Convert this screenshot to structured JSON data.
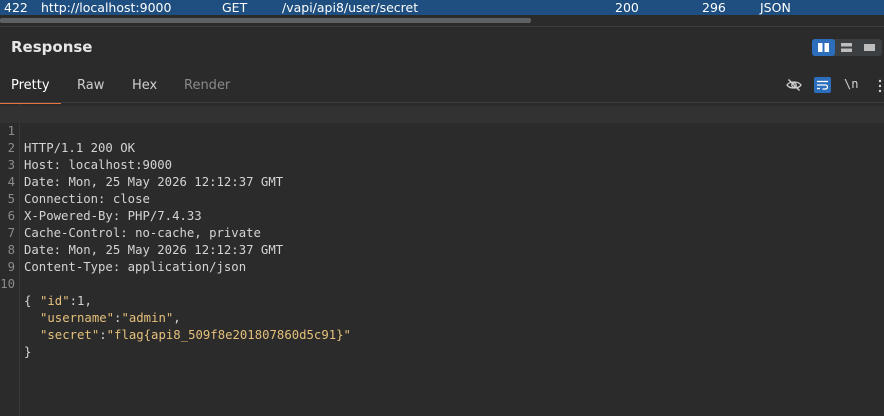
{
  "history_row": {
    "id": "422",
    "host": "http://localhost:9000",
    "method": "GET",
    "url": "/vapi/api8/user/secret",
    "status": "200",
    "length": "296",
    "mime": "JSON"
  },
  "panel": {
    "title": "Response",
    "layout_icons": [
      "split-vertical-icon",
      "split-horizontal-icon",
      "single-pane-icon"
    ]
  },
  "tabs": [
    {
      "label": "Pretty",
      "state": "active"
    },
    {
      "label": "Raw",
      "state": "normal"
    },
    {
      "label": "Hex",
      "state": "normal"
    },
    {
      "label": "Render",
      "state": "disabled"
    }
  ],
  "toolbar": {
    "hide_icon": "eye-slash-icon",
    "wrap_icon": "word-wrap-icon",
    "newline_label": "\\n",
    "menu_icon": "kebab-menu-icon"
  },
  "headers": [
    {
      "ln": "1",
      "text": "HTTP/1.1 200 OK"
    },
    {
      "ln": "2",
      "name": "Host",
      "value": "localhost:9000"
    },
    {
      "ln": "3",
      "name": "Date",
      "value": "Mon, 25 May 2026 12:12:37 GMT"
    },
    {
      "ln": "4",
      "name": "Connection",
      "value": "close"
    },
    {
      "ln": "5",
      "name": "X-Powered-By",
      "value": "PHP/7.4.33"
    },
    {
      "ln": "6",
      "name": "Cache-Control",
      "value": "no-cache, private"
    },
    {
      "ln": "7",
      "name": "Date",
      "value": "Mon, 25 May 2026 12:12:37 GMT"
    },
    {
      "ln": "8",
      "name": "Content-Type",
      "value": "application/json"
    },
    {
      "ln": "9",
      "text": ""
    }
  ],
  "body": {
    "ln": "10",
    "open": "{",
    "close": "}",
    "fields": [
      {
        "key": "\"id\"",
        "value": "1",
        "type": "num"
      },
      {
        "key": "\"username\"",
        "value": "\"admin\"",
        "type": "str"
      },
      {
        "key": "\"secret\"",
        "value": "\"flag{api8_509f8e201807860d5c91}\"",
        "type": "str"
      }
    ]
  },
  "colors": {
    "selected_row": "#1e4f80",
    "active_tab_underline": "#e8743b",
    "accent_button": "#2d6ebc",
    "json_string": "#e5c07b"
  }
}
